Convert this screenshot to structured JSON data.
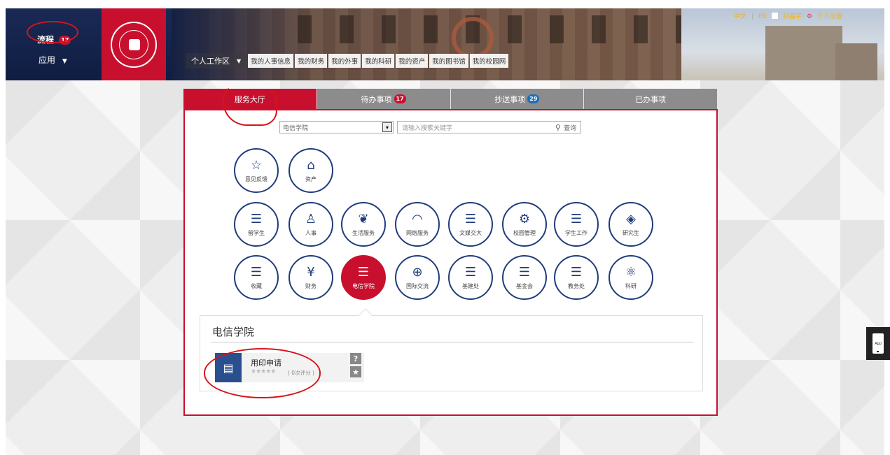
{
  "header": {
    "flow_label": "流程",
    "flow_count": "17",
    "apps_label": "应用",
    "apps_caret": "▼",
    "top_links": {
      "lang_cn": "中文",
      "sep": "|",
      "lang_en": "EN",
      "user_name": "孙基宇",
      "settings": "个人设置"
    },
    "workspace_label": "个人工作区",
    "workspace_caret": "▼",
    "menu_links": [
      "我的人事信息",
      "我的财务",
      "我的外事",
      "我的科研",
      "我的资产",
      "我的图书馆",
      "我的校园网"
    ]
  },
  "tabs": [
    {
      "label": "服务大厅",
      "badge": ""
    },
    {
      "label": "待办事项",
      "badge": "17"
    },
    {
      "label": "抄送事项",
      "badge": "29"
    },
    {
      "label": "已办事项",
      "badge": ""
    }
  ],
  "search": {
    "selected_category": "电信学院",
    "placeholder": "请输入搜索关键字",
    "button_label": "查询"
  },
  "services": {
    "row1": [
      {
        "label": "意见反馈",
        "icon": "☆",
        "icon_name": "star-icon"
      },
      {
        "label": "资产",
        "icon": "⌂",
        "icon_name": "home-icon"
      }
    ],
    "row2": [
      {
        "label": "留学生",
        "icon": "☰",
        "icon_name": "list-icon"
      },
      {
        "label": "人事",
        "icon": "♙",
        "icon_name": "person-icon"
      },
      {
        "label": "生活服务",
        "icon": "❦",
        "icon_name": "plant-icon"
      },
      {
        "label": "网络服务",
        "icon": "◠",
        "icon_name": "wifi-icon"
      },
      {
        "label": "文媒交大",
        "icon": "☰",
        "icon_name": "list-icon"
      },
      {
        "label": "校园管理",
        "icon": "⚙",
        "icon_name": "gear-icon"
      },
      {
        "label": "学生工作",
        "icon": "☰",
        "icon_name": "list-icon"
      },
      {
        "label": "研究生",
        "icon": "◈",
        "icon_name": "graduation-cap-icon"
      }
    ],
    "row3": [
      {
        "label": "收藏",
        "icon": "☰",
        "icon_name": "list-icon"
      },
      {
        "label": "财务",
        "icon": "¥",
        "icon_name": "yuan-icon"
      },
      {
        "label": "电信学院",
        "icon": "☰",
        "icon_name": "list-icon"
      },
      {
        "label": "国际交流",
        "icon": "⊕",
        "icon_name": "globe-icon"
      },
      {
        "label": "基建处",
        "icon": "☰",
        "icon_name": "list-icon"
      },
      {
        "label": "基金会",
        "icon": "☰",
        "icon_name": "list-icon"
      },
      {
        "label": "教务处",
        "icon": "☰",
        "icon_name": "list-icon"
      },
      {
        "label": "科研",
        "icon": "⚛",
        "icon_name": "atom-icon"
      }
    ]
  },
  "detail": {
    "title": "电信学院",
    "app": {
      "name": "用印申请",
      "stars": "★★★★★",
      "rating_text": "( 0次评分 )",
      "help_label": "?",
      "fav_label": "★"
    }
  },
  "app_float": {
    "label": "App"
  },
  "colors": {
    "brand_red": "#c8102e",
    "navy": "#1f3c7a",
    "tab_gray": "#8c8c8c",
    "annotation_red": "#d6141c"
  }
}
